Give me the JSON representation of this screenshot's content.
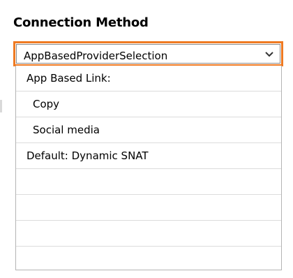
{
  "section": {
    "heading": "Connection Method"
  },
  "select": {
    "value": "AppBasedProviderSelection",
    "chevron_icon": "chevron-down-icon",
    "accent_color": "#ef7a22"
  },
  "dropdown": {
    "options": [
      {
        "label": "App Based Link:"
      },
      {
        "label": "Copy"
      },
      {
        "label": "Social media"
      },
      {
        "label": "Default: Dynamic SNAT"
      },
      {
        "label": ""
      },
      {
        "label": ""
      },
      {
        "label": ""
      },
      {
        "label": ""
      }
    ]
  }
}
